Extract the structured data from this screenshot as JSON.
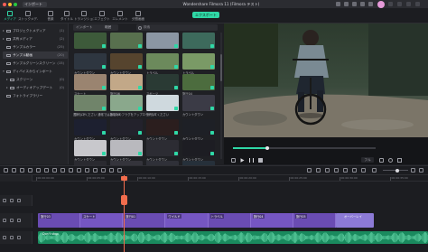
{
  "window": {
    "title": "Wondershare Filmora 11 (Filmora テスト)",
    "import_label": "インポート",
    "export_label": "エクスポート"
  },
  "toolbar": {
    "items": [
      {
        "label": "メディア",
        "icon": "media-icon",
        "active": true
      },
      {
        "label": "ストックメディア",
        "icon": "stock-media-icon"
      },
      {
        "label": "音楽",
        "icon": "music-icon"
      },
      {
        "label": "タイトル",
        "icon": "title-icon"
      },
      {
        "label": "トランジション",
        "icon": "transition-icon"
      },
      {
        "label": "エフェクト",
        "icon": "effect-icon"
      },
      {
        "label": "エレメント",
        "icon": "element-icon"
      },
      {
        "label": "分割画面",
        "icon": "split-screen-icon"
      }
    ]
  },
  "sidebar": {
    "items": [
      {
        "label": "プロジェクトメディア",
        "count": "(1)",
        "caret": "▸"
      },
      {
        "label": "共有メディア",
        "count": "(2)",
        "caret": "▸"
      },
      {
        "label": "サンプルカラー",
        "count": "(25)",
        "caret": ""
      },
      {
        "label": "サンプル動画",
        "count": "(20)",
        "caret": "",
        "active": true
      },
      {
        "label": "サンプルグリーンスクリーン",
        "count": "(15)",
        "caret": ""
      },
      {
        "label": "ディバイスからインポート",
        "count": "",
        "caret": "▾"
      },
      {
        "label": "スクリーン",
        "count": "(0)",
        "caret": "▸"
      },
      {
        "label": "オーディオアップデート",
        "count": "(0)",
        "caret": "▸"
      },
      {
        "label": "フォトライブラリー",
        "count": "",
        "caret": ""
      }
    ]
  },
  "media_browser": {
    "dropdown_label": "インポート",
    "filter_label": "範囲",
    "search_placeholder": "検索",
    "thumbnails": [
      {
        "label": "",
        "bg": "#3d5a3a"
      },
      {
        "label": "",
        "bg": "#58704e"
      },
      {
        "label": "",
        "bg": "#8b96a3"
      },
      {
        "label": "",
        "bg": "#3d6a5c"
      },
      {
        "label": "カウントダウン",
        "bg": "#2e3640"
      },
      {
        "label": "カウントダウン",
        "bg": "#56442e"
      },
      {
        "label": "トラベル",
        "bg": "#6c8a5c"
      },
      {
        "label": "トラベル",
        "bg": "#7a9a66"
      },
      {
        "label": "スケート",
        "bg": "#9a8470"
      },
      {
        "label": "旅行06",
        "bg": "#c2a888"
      },
      {
        "label": "スポーツ",
        "bg": "#2a3a34"
      },
      {
        "label": "旅行04",
        "bg": "#4c6c3e"
      },
      {
        "label": "ワイルド",
        "bg": "#70846a"
      },
      {
        "label": "旅行03",
        "bg": "#8aa88c"
      },
      {
        "label": "旅行05",
        "bg": "#cfd9de"
      },
      {
        "label": "カウントダウン",
        "bg": "#3b3b46"
      },
      {
        "label": "カウントダウン",
        "bg": "#1d2030"
      },
      {
        "label": "カウントダウン",
        "bg": "#23222c"
      },
      {
        "label": "カウントダウン",
        "bg": "#2b1e1e"
      },
      {
        "label": "カウントダウン",
        "bg": "#1e2026"
      },
      {
        "label": "カウントダウン",
        "bg": "#c8c8cc"
      },
      {
        "label": "カウントダウン",
        "bg": "#b9b9be"
      },
      {
        "label": "カウントダウン",
        "bg": "#2c2c33"
      },
      {
        "label": "カウントダウン",
        "bg": "#1d1d23"
      },
      {
        "label": "",
        "bg": "#2a2a30"
      },
      {
        "label": "",
        "bg": "#34343b"
      },
      {
        "label": "",
        "bg": "#2f3038"
      },
      {
        "label": "",
        "bg": "#26303a"
      }
    ],
    "caption": "選択してください 通常ではあなたのフラグをアップロードしてください"
  },
  "preview": {
    "zoom_label": "フル"
  },
  "timeline": {
    "ruler_labels": [
      "00:00:00:00",
      "00:00:05:00",
      "00:00:10:00",
      "00:00:15:00",
      "00:00:20:00",
      "00:00:25:00",
      "00:00:30:00",
      "00:00:35:00"
    ],
    "clips": [
      {
        "label": "旅行03"
      },
      {
        "label": "スケート"
      },
      {
        "label": "旅行01"
      },
      {
        "label": "ワイルド"
      },
      {
        "label": "トラベル"
      },
      {
        "label": "旅行04"
      },
      {
        "label": "旅行05"
      }
    ],
    "tail_label": "オーバーレイ",
    "audio_label": "Don't stop"
  },
  "colors": {
    "accent": "#2fd8a6",
    "playhead": "#f26d4d",
    "video_clip": "#6f4fb8",
    "audio_clip": "#1a8a5e"
  }
}
